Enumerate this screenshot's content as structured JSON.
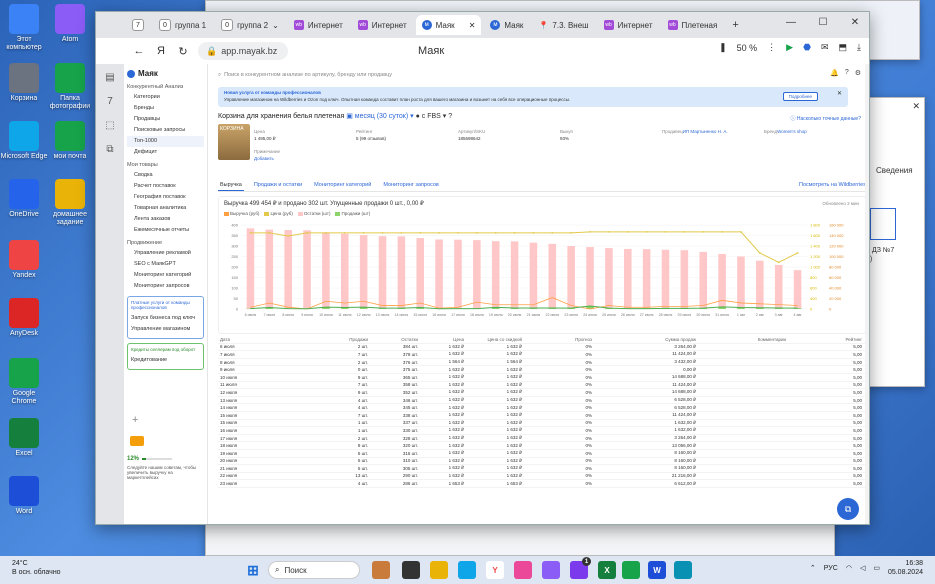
{
  "desktop": {
    "icons": [
      {
        "label": "Этот компьютер",
        "color": "#3b82f6"
      },
      {
        "label": "Корзина",
        "color": "#6b7280"
      },
      {
        "label": "Microsoft Edge",
        "color": "#0ea5e9"
      },
      {
        "label": "OneDrive",
        "color": "#2563eb"
      },
      {
        "label": "Yandex",
        "color": "#ef4444"
      },
      {
        "label": "AnyDesk",
        "color": "#dc2626"
      },
      {
        "label": "Google Chrome",
        "color": "#16a34a"
      },
      {
        "label": "Excel",
        "color": "#15803d"
      },
      {
        "label": "Word",
        "color": "#1d4ed8"
      },
      {
        "label": "Atom",
        "color": "#8b5cf6"
      },
      {
        "label": "Папка фотографии",
        "color": "#16a34a"
      },
      {
        "label": "мои почта",
        "color": "#16a34a"
      },
      {
        "label": "домашнее задание",
        "color": "#eab308"
      }
    ],
    "bg_window_text": "Сведения",
    "bg_window_file": "ц ДЗ №7\n1)"
  },
  "browser": {
    "tabs": [
      {
        "label": "группа 1",
        "badge": "0"
      },
      {
        "label": "группа 2",
        "badge": "0"
      },
      {
        "label": "Интернет"
      },
      {
        "label": "Интернет"
      },
      {
        "label": "Маяк",
        "active": true
      },
      {
        "label": "Маяк"
      },
      {
        "label": "7.3. Внеш"
      },
      {
        "label": "Интернет"
      },
      {
        "label": "Плетеная"
      }
    ],
    "workspace_num": "7",
    "url": "app.mayak.bz",
    "page_title": "Маяк",
    "zoom": "50 %"
  },
  "sidebar": {
    "logo": "Маяк",
    "sections": [
      {
        "title": "Конкурентный Анализ",
        "items": [
          "Категории",
          "Бренды",
          "Продавцы",
          "Поисковые запросы",
          "Топ-1000",
          "Дефицит"
        ]
      },
      {
        "title": "Мои товары",
        "items": [
          "Сводка",
          "Расчет поставок",
          "География поставок",
          "Товарная аналитика",
          "Лента заказов",
          "Ежемесячные отчеты"
        ]
      },
      {
        "title": "Продвижение",
        "items": [
          "Управление рекламой",
          "SEO с МаякGPT",
          "Мониторинг категорий",
          "Мониторинг запросов"
        ]
      }
    ],
    "promo1_title": "Платные услуги от команды профессионалов",
    "promo1_items": [
      "Запуск бизнеса под ключ",
      "Управление магазином"
    ],
    "promo2_title": "Кредиты селлерам под оборот",
    "promo2_item": "Кредитование",
    "progress": "12%",
    "progress_note": "Следуйте нашим советам, чтобы увеличить выручку на маркетплейсах"
  },
  "main": {
    "search_placeholder": "Поиск в конкурентном анализе по артикулу, бренду или продавцу",
    "banner_title": "Новая услуга от команды профессионалов",
    "banner_text": "Управление магазином на Wildberries и Ozon под ключ. Опытная команда составит план роста для вашего магазина и возьмет на себя все операционные процессы.",
    "banner_btn": "Подробнее",
    "product_title": "Корзина для хранения белья плетеная",
    "period": "месяц (30 суток)",
    "fbs": "с FBS",
    "accuracy_link": "Насколько точные данные?",
    "product": {
      "img_label": "КОРЗИНА",
      "price_label": "Цена",
      "price": "1 495,00 ₽",
      "rating_label": "Рейтинг",
      "rating": "5 (99 отзывов)",
      "sku_label": "Артикул/SKU",
      "sku": "185698642",
      "buyout_label": "Выкуп",
      "buyout": "93%",
      "seller_label": "Продавец",
      "seller": "ИП Мартыненко Н. А.",
      "brand_label": "Бренд",
      "brand": "Women's shop",
      "note_label": "Примечание",
      "note_add": "Добавить"
    },
    "tabs": [
      "Выручка",
      "Продажи и остатки",
      "Мониторинг категорий",
      "Мониторинг запросов"
    ],
    "wb_link": "Посмотреть на Wildberries"
  },
  "chart_data": {
    "type": "bar",
    "title": "Выручка 499 454 ₽ и продано 302 шт.  Упущенные продажи 0 шт., 0,00 ₽",
    "updated": "Обновлено 2 мин",
    "legend": [
      {
        "name": "Выручка (руб)",
        "color": "#ff9f43"
      },
      {
        "name": "Цена (руб)",
        "color": "#e2c94a"
      },
      {
        "name": "Остатки (шт)",
        "color": "#ffc7c7"
      },
      {
        "name": "Продажи (шт)",
        "color": "#8bd36a"
      }
    ],
    "categories": [
      "6 июля",
      "7 июля",
      "8 июля",
      "9 июля",
      "10 июля",
      "11 июля",
      "12 июля",
      "13 июля",
      "14 июля",
      "15 июля",
      "16 июля",
      "17 июля",
      "18 июля",
      "19 июля",
      "20 июля",
      "21 июля",
      "22 июля",
      "23 июля",
      "24 июля",
      "25 июля",
      "26 июля",
      "27 июля",
      "28 июля",
      "29 июля",
      "30 июля",
      "31 июля",
      "1 авг",
      "2 авг",
      "3 авг",
      "4 авг"
    ],
    "left_ticks": [
      "400",
      "350",
      "300",
      "250",
      "200",
      "150",
      "100",
      "50",
      "0"
    ],
    "right_ticks_1": [
      "1 800",
      "1 600",
      "1 400",
      "1 200",
      "1 000",
      "800",
      "600",
      "400",
      "0"
    ],
    "right_ticks_2": [
      "160 000",
      "140 000",
      "120 000",
      "100 000",
      "80 000",
      "60 000",
      "40 000",
      "20 000",
      "0"
    ],
    "ylim_left": [
      0,
      400
    ],
    "ylim_price": [
      0,
      1800
    ],
    "series": [
      {
        "name": "Остатки (шт)",
        "values": [
          384,
          378,
          376,
          375,
          365,
          358,
          352,
          347,
          346,
          338,
          331,
          330,
          328,
          323,
          322,
          316,
          310,
          300,
          295,
          290,
          286,
          285,
          282,
          280,
          272,
          262,
          250,
          230,
          210,
          185
        ]
      },
      {
        "name": "Продажи (шт)",
        "values": [
          2,
          7,
          2,
          1,
          9,
          7,
          9,
          4,
          4,
          7,
          1,
          2,
          2,
          8,
          5,
          5,
          5,
          4,
          14,
          4,
          2,
          2,
          3,
          3,
          4,
          10,
          7,
          6,
          5,
          4
        ]
      },
      {
        "name": "Цена (руб)",
        "values": [
          1632,
          1632,
          1564,
          1632,
          1632,
          1632,
          1632,
          1632,
          1632,
          1632,
          1632,
          1632,
          1632,
          1632,
          1632,
          1632,
          1632,
          1632,
          1653,
          1653,
          1653,
          1653,
          1653,
          1653,
          1653,
          1653,
          1653,
          1200,
          1000,
          1200
        ]
      },
      {
        "name": "Выручка (руб)",
        "values": [
          3264,
          11424,
          3432,
          0,
          14688,
          11424,
          14688,
          6528,
          6528,
          11424,
          1632,
          3264,
          13056,
          8160,
          8160,
          8160,
          21760,
          6612,
          0,
          6612,
          3306,
          3306,
          4959,
          4959,
          6612,
          16530,
          11571,
          9918,
          8265,
          6612
        ]
      }
    ]
  },
  "table": {
    "headers": [
      "Дата",
      "Продажи",
      "Остатки",
      "Цена",
      "Цена со скидкой",
      "Прогноз",
      "Сумма продаж",
      "Комментарии",
      "Рейтинг"
    ],
    "rows": [
      [
        "6 июля",
        "2 шт.",
        "384 шт.",
        "1 632 ₽",
        "1 632 ₽",
        "0%",
        "3 264,00 ₽",
        "",
        "5,00"
      ],
      [
        "7 июля",
        "7 шт.",
        "378 шт.",
        "1 632 ₽",
        "1 632 ₽",
        "0%",
        "11 424,00 ₽",
        "",
        "5,00"
      ],
      [
        "8 июля",
        "2 шт.",
        "376 шт.",
        "1 564 ₽",
        "1 564 ₽",
        "0%",
        "3 432,00 ₽",
        "",
        "5,00"
      ],
      [
        "9 июля",
        "0 шт.",
        "375 шт.",
        "1 632 ₽",
        "1 632 ₽",
        "0%",
        "0,00 ₽",
        "",
        "5,00"
      ],
      [
        "10 июля",
        "9 шт.",
        "365 шт.",
        "1 632 ₽",
        "1 632 ₽",
        "0%",
        "14 688,00 ₽",
        "",
        "5,00"
      ],
      [
        "11 июля",
        "7 шт.",
        "358 шт.",
        "1 632 ₽",
        "1 632 ₽",
        "0%",
        "11 424,00 ₽",
        "",
        "5,00"
      ],
      [
        "12 июля",
        "9 шт.",
        "352 шт.",
        "1 632 ₽",
        "1 632 ₽",
        "0%",
        "14 688,00 ₽",
        "",
        "5,00"
      ],
      [
        "13 июля",
        "4 шт.",
        "346 шт.",
        "1 632 ₽",
        "1 632 ₽",
        "0%",
        "6 528,00 ₽",
        "",
        "5,00"
      ],
      [
        "14 июля",
        "4 шт.",
        "345 шт.",
        "1 632 ₽",
        "1 632 ₽",
        "0%",
        "6 528,00 ₽",
        "",
        "5,00"
      ],
      [
        "15 июля",
        "7 шт.",
        "338 шт.",
        "1 632 ₽",
        "1 632 ₽",
        "0%",
        "11 424,00 ₽",
        "",
        "5,00"
      ],
      [
        "15 июля",
        "1 шт.",
        "337 шт.",
        "1 632 ₽",
        "1 632 ₽",
        "0%",
        "1 632,00 ₽",
        "",
        "5,00"
      ],
      [
        "16 июля",
        "1 шт.",
        "330 шт.",
        "1 632 ₽",
        "1 632 ₽",
        "0%",
        "1 632,00 ₽",
        "",
        "5,00"
      ],
      [
        "17 июля",
        "2 шт.",
        "328 шт.",
        "1 632 ₽",
        "1 632 ₽",
        "0%",
        "3 264,00 ₽",
        "",
        "5,00"
      ],
      [
        "18 июля",
        "8 шт.",
        "320 шт.",
        "1 632 ₽",
        "1 632 ₽",
        "0%",
        "13 056,00 ₽",
        "",
        "5,00"
      ],
      [
        "19 июля",
        "5 шт.",
        "316 шт.",
        "1 632 ₽",
        "1 632 ₽",
        "0%",
        "8 160,00 ₽",
        "",
        "5,00"
      ],
      [
        "20 июля",
        "5 шт.",
        "310 шт.",
        "1 632 ₽",
        "1 632 ₽",
        "0%",
        "8 160,00 ₽",
        "",
        "5,00"
      ],
      [
        "21 июля",
        "5 шт.",
        "305 шт.",
        "1 632 ₽",
        "1 632 ₽",
        "0%",
        "8 160,00 ₽",
        "",
        "5,00"
      ],
      [
        "22 июля",
        "13 шт.",
        "290 шт.",
        "1 632 ₽",
        "1 632 ₽",
        "0%",
        "21 216,00 ₽",
        "",
        "5,00"
      ],
      [
        "23 июля",
        "4 шт.",
        "286 шт.",
        "1 653 ₽",
        "1 653 ₽",
        "0%",
        "6 612,00 ₽",
        "",
        "5,00"
      ]
    ]
  },
  "taskbar": {
    "temp": "24°C",
    "weather": "В осн. облачно",
    "search": "Поиск",
    "lang": "РУС",
    "time": "16:38",
    "date": "05.08.2024",
    "notif": "1"
  }
}
